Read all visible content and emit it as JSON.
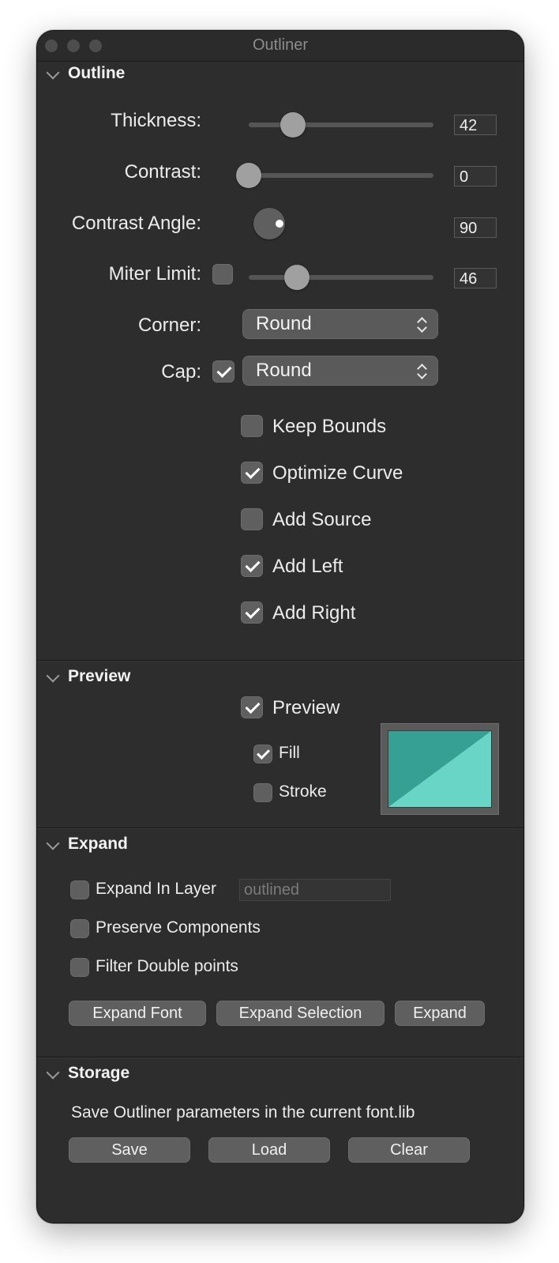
{
  "window": {
    "title": "Outliner"
  },
  "colors": {
    "swatch_dark": "#35a093",
    "swatch_light": "#69d5c7"
  },
  "outline": {
    "header": "Outline",
    "thickness": {
      "label": "Thickness:",
      "value": "42",
      "level": 0.24
    },
    "contrast": {
      "label": "Contrast:",
      "value": "0",
      "level": 0.0
    },
    "contrast_angle": {
      "label": "Contrast Angle:",
      "value": "90",
      "angle_deg": 90
    },
    "miter_limit": {
      "label": "Miter Limit:",
      "value": "46",
      "checked": false,
      "level": 0.26
    },
    "corner": {
      "label": "Corner:",
      "selected": "Round"
    },
    "cap": {
      "label": "Cap:",
      "checked": true,
      "selected": "Round"
    },
    "options": [
      {
        "label": "Keep Bounds",
        "checked": false
      },
      {
        "label": "Optimize Curve",
        "checked": true
      },
      {
        "label": "Add Source",
        "checked": false
      },
      {
        "label": "Add Left",
        "checked": true
      },
      {
        "label": "Add Right",
        "checked": true
      }
    ]
  },
  "preview": {
    "header": "Preview",
    "preview": {
      "label": "Preview",
      "checked": true
    },
    "fill": {
      "label": "Fill",
      "checked": true
    },
    "stroke": {
      "label": "Stroke",
      "checked": false
    }
  },
  "expand": {
    "header": "Expand",
    "expand_in_layer": {
      "label": "Expand In Layer",
      "checked": false,
      "placeholder": "outlined"
    },
    "preserve_components": {
      "label": "Preserve Components",
      "checked": false
    },
    "filter_double_points": {
      "label": "Filter Double points",
      "checked": false
    },
    "buttons": {
      "expand_font": "Expand Font",
      "expand_selection": "Expand Selection",
      "expand": "Expand"
    }
  },
  "storage": {
    "header": "Storage",
    "description": "Save Outliner parameters in the current font.lib",
    "buttons": {
      "save": "Save",
      "load": "Load",
      "clear": "Clear"
    }
  }
}
